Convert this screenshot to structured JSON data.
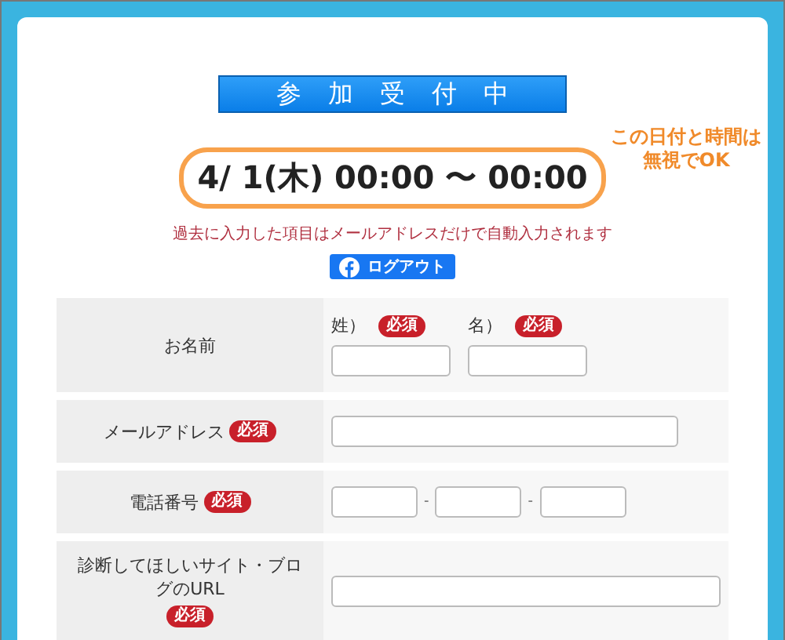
{
  "banner": "参加受付中",
  "date": "4/ 1(木) 00:00 〜 00:00",
  "annotation": [
    "この日付と時間は",
    "無視でOK"
  ],
  "note": "過去に入力した項目はメールアドレスだけで自動入力されます",
  "logout_button": "ログアウト",
  "fields": [
    {
      "kind": "name",
      "label": "お名前",
      "parts": [
        {
          "label": "姓）",
          "badge": "必須"
        },
        {
          "label": "名）",
          "badge": "必須"
        }
      ]
    },
    {
      "kind": "email",
      "label": "メールアドレス",
      "badge": "必須"
    },
    {
      "kind": "phone",
      "label": "電話番号",
      "badge": "必須",
      "separators": [
        "-",
        "-"
      ]
    },
    {
      "kind": "url",
      "label": "診断してほしいサイト・ブログのURL",
      "badge": "必須"
    }
  ]
}
